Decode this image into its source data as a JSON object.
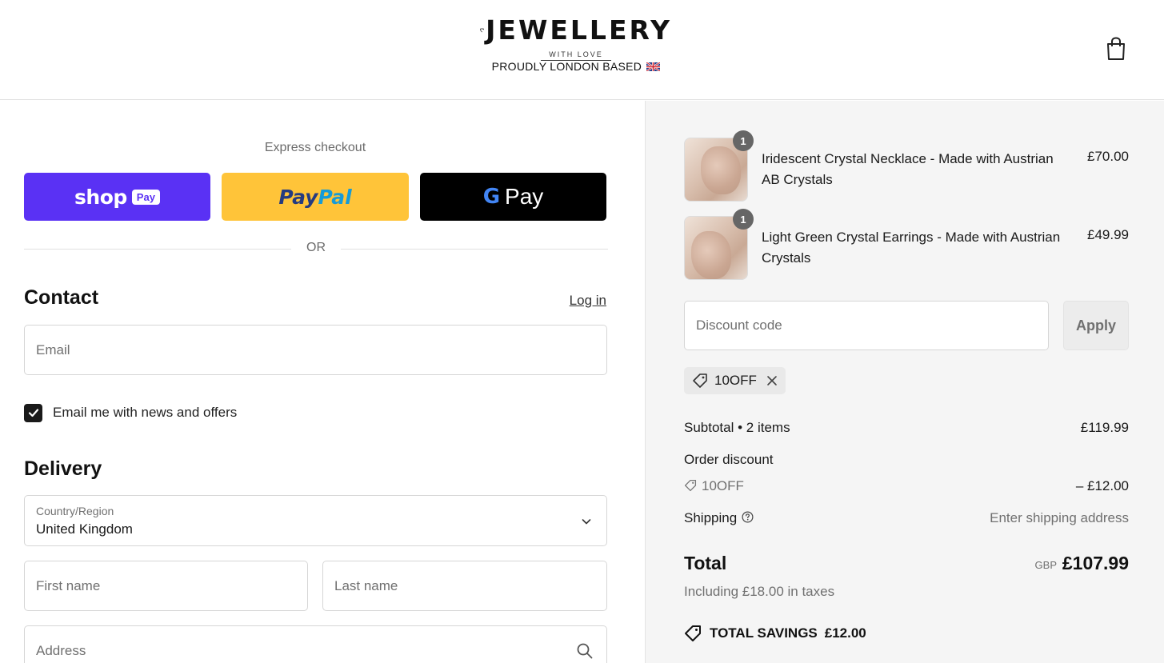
{
  "header": {
    "brand": "JEWELLERY",
    "brand_sub": "WITH LOVE",
    "tagline": "PROUDLY LONDON BASED",
    "cart_icon": "shopping-bag-icon"
  },
  "express": {
    "title": "Express checkout",
    "shop_text": "shop",
    "shop_pay": "Pay",
    "paypal_a": "Pay",
    "paypal_b": "Pal",
    "gpay_g": "G",
    "gpay_text": "Pay",
    "or_text": "OR",
    "colors": {
      "shop": "#5a31f4",
      "paypal": "#ffc439",
      "gpay": "#000000"
    }
  },
  "contact": {
    "title": "Contact",
    "login": "Log in",
    "email_placeholder": "Email",
    "newsletter_label": "Email me with news and offers",
    "newsletter_checked": true
  },
  "delivery": {
    "title": "Delivery",
    "country_label": "Country/Region",
    "country_value": "United Kingdom",
    "first_name_placeholder": "First name",
    "last_name_placeholder": "Last name",
    "address_placeholder": "Address"
  },
  "order": {
    "items": [
      {
        "name": "Iridescent Crystal Necklace - Made with Austrian AB Crystals",
        "price": "£70.00",
        "qty": "1"
      },
      {
        "name": "Light Green Crystal Earrings - Made with Austrian Crystals",
        "price": "£49.99",
        "qty": "1"
      }
    ],
    "discount_placeholder": "Discount code",
    "apply_label": "Apply",
    "applied_code": "10OFF",
    "subtotal_label": "Subtotal • 2 items",
    "subtotal_value": "£119.99",
    "order_discount_label": "Order discount",
    "order_discount_code": "10OFF",
    "order_discount_value": "– £12.00",
    "shipping_label": "Shipping",
    "shipping_value": "Enter shipping address",
    "total_label": "Total",
    "total_currency": "GBP",
    "total_value": "£107.99",
    "tax_note": "Including £18.00 in taxes",
    "savings_label": "TOTAL SAVINGS",
    "savings_value": "£12.00"
  }
}
